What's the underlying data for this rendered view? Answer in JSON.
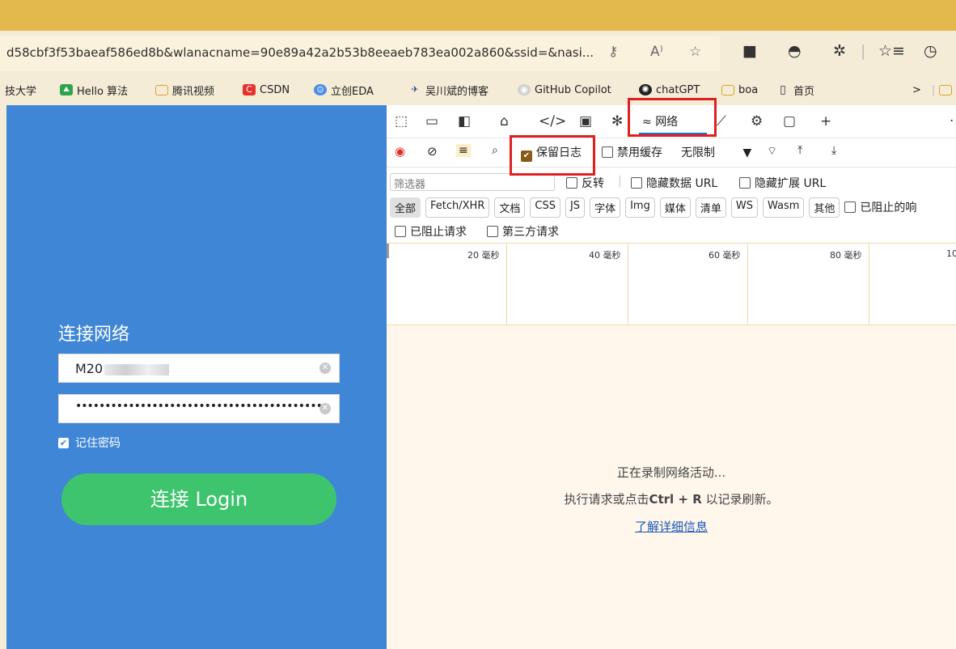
{
  "browser": {
    "url": "d58cbf3f53baeaf586ed8b&wlanacname=90e89a42a2b53b8eeaeb783ea002a860&ssid=&nasi...",
    "bookmarks": [
      {
        "label": "技大学",
        "icon": "partial-bookmark"
      },
      {
        "label": "Hello 算法",
        "icon": "hello-algo-icon"
      },
      {
        "label": "腾讯视频",
        "icon": "folder-icon"
      },
      {
        "label": "CSDN",
        "icon": "csdn-icon"
      },
      {
        "label": "立创EDA",
        "icon": "lceda-icon"
      },
      {
        "label": "吴川斌的博客",
        "icon": "blog-icon"
      },
      {
        "label": "GitHub Copilot",
        "icon": "github-copilot-icon"
      },
      {
        "label": "chatGPT",
        "icon": "chatgpt-icon"
      },
      {
        "label": "boa",
        "icon": "folder-icon"
      },
      {
        "label": "首页",
        "icon": "page-icon"
      }
    ],
    "more_chevron": ">"
  },
  "login": {
    "title": "连接网络",
    "username_visible": "M20",
    "password_dots": "••••••••••••••••••••••••••••••••••••••••••",
    "remember_label": "记住密码",
    "remember_checked": true,
    "button_label": "连接 Login"
  },
  "devtools": {
    "network_tab_label": "网络",
    "preserve_log_label": "保留日志",
    "preserve_log_checked": true,
    "disable_cache_label": "禁用缓存",
    "throttle_value": "无限制",
    "filter_placeholder": "筛选器",
    "invert_label": "反转",
    "hide_data_url_label": "隐藏数据 URL",
    "hide_ext_url_label": "隐藏扩展 URL",
    "type_filters": [
      "全部",
      "Fetch/XHR",
      "文档",
      "CSS",
      "JS",
      "字体",
      "Img",
      "媒体",
      "清单",
      "WS",
      "Wasm",
      "其他"
    ],
    "blocked_response_label": "已阻止的响",
    "blocked_requests_label": "已阻止请求",
    "third_party_label": "第三方请求",
    "timeline_ticks": [
      "20 毫秒",
      "40 毫秒",
      "60 毫秒",
      "80 毫秒",
      "10"
    ],
    "recording_text": "正在录制网络活动...",
    "hint_prefix": "执行请求或点击",
    "hint_shortcut": "Ctrl + R",
    "hint_suffix": "以记录刷新。",
    "learn_more": "了解详细信息"
  },
  "colors": {
    "highlight": "#e0201f",
    "login_bg": "#3f87d6",
    "login_button": "#3ec46d",
    "top_band": "#e3b94e"
  }
}
